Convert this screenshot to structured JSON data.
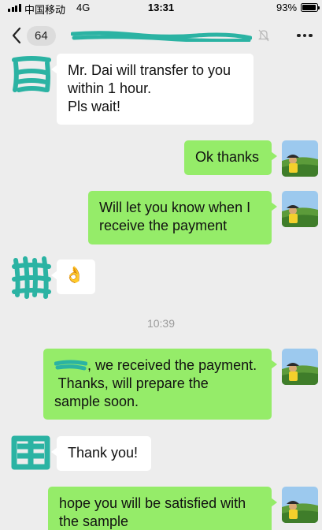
{
  "status_bar": {
    "carrier": "中国移动",
    "network": "4G",
    "time": "13:31",
    "battery_percent": "93%",
    "battery_level": 0.93
  },
  "nav": {
    "unread_count": "64",
    "title": "",
    "accent_color": "#2bb3a3"
  },
  "messages": [
    {
      "side": "left",
      "lines": [
        "Mr. Dai will transfer to you",
        "within 1 hour.",
        "Pls wait!"
      ]
    },
    {
      "side": "right",
      "lines": [
        "Ok thanks"
      ]
    },
    {
      "side": "right",
      "lines": [
        "Will let you know when I",
        "receive the payment"
      ]
    },
    {
      "side": "left",
      "emoji": "👌"
    },
    {
      "side": "right",
      "lines": [
        ", we received the payment.",
        " Thanks, will prepare the",
        "sample soon."
      ]
    },
    {
      "side": "left",
      "lines": [
        "Thank you!"
      ]
    },
    {
      "side": "right",
      "lines": [
        "hope you will be satisfied with",
        "the sample"
      ]
    }
  ],
  "time_divider": "10:39",
  "colors": {
    "background": "#ededed",
    "outgoing_bubble": "#95ec69",
    "incoming_bubble": "#ffffff",
    "redaction": "#2bb3a3"
  }
}
